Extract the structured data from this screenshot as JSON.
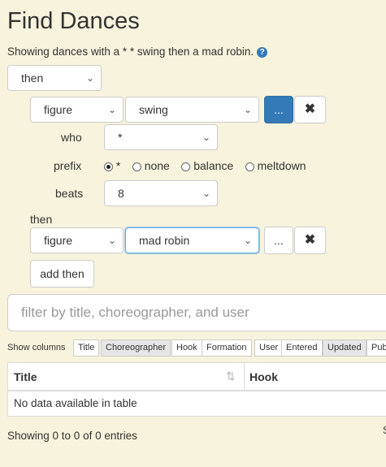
{
  "page": {
    "title": "Find Dances",
    "subtitle": "Showing dances with a * * swing then a mad robin."
  },
  "query": {
    "top_operator": "then",
    "clause1": {
      "kind": "figure",
      "figure": "swing",
      "more_label": "...",
      "remove_label": "✖",
      "who_label": "who",
      "who_value": "*",
      "prefix_label": "prefix",
      "prefix_options": [
        "*",
        "none",
        "balance",
        "meltdown"
      ],
      "prefix_selected": "*",
      "beats_label": "beats",
      "beats_value": "8"
    },
    "then_label": "then",
    "clause2": {
      "kind": "figure",
      "figure": "mad robin",
      "more_label": "...",
      "remove_label": "✖"
    },
    "add_then_label": "add then"
  },
  "filter": {
    "placeholder": "filter by title, choreographer, and user"
  },
  "columns": {
    "label": "Show columns",
    "toggles": [
      {
        "label": "Title",
        "active": false
      },
      {
        "label": "Choreographer",
        "active": true
      },
      {
        "label": "Hook",
        "active": false
      },
      {
        "label": "Formation",
        "active": false
      },
      {
        "label": "User",
        "active": false
      },
      {
        "label": "Entered",
        "active": false
      },
      {
        "label": "Updated",
        "active": true
      },
      {
        "label": "Pub",
        "active": false
      }
    ]
  },
  "table": {
    "headers": [
      "Title",
      "Hook"
    ],
    "empty_text": "No data available in table",
    "sort_icon": "⇅"
  },
  "footer": {
    "entries_text": "Showing 0 to 0 of 0 entries",
    "right_fragment": "S"
  },
  "colors": {
    "primary": "#337ab7",
    "background": "#f7f3dc"
  }
}
